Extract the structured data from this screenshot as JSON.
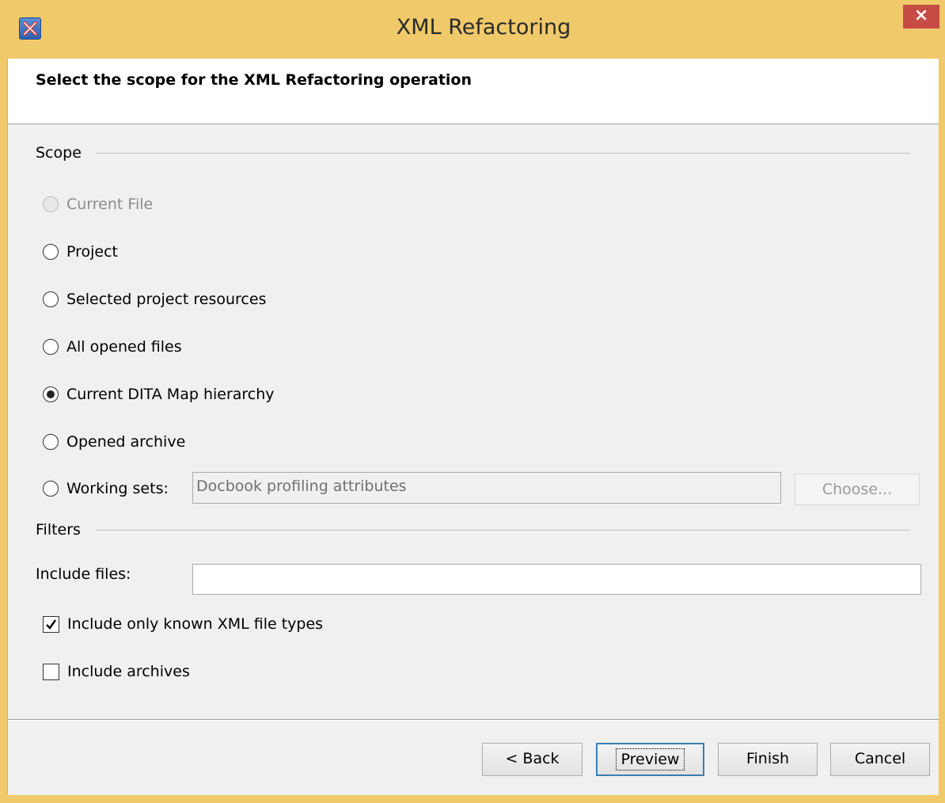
{
  "window": {
    "title": "XML Refactoring",
    "close_glyph": "×",
    "app_icon": "xml-refactoring-app-icon"
  },
  "header": {
    "title": "Select the scope for the XML Refactoring operation"
  },
  "scope": {
    "section_label": "Scope",
    "options": [
      {
        "label": "Current File",
        "checked": false,
        "disabled": true
      },
      {
        "label": "Project",
        "checked": false,
        "disabled": false
      },
      {
        "label": "Selected project resources",
        "checked": false,
        "disabled": false
      },
      {
        "label": "All opened files",
        "checked": false,
        "disabled": false
      },
      {
        "label": "Current DITA Map hierarchy",
        "checked": true,
        "disabled": false
      },
      {
        "label": "Opened archive",
        "checked": false,
        "disabled": false
      },
      {
        "label": "Working sets:",
        "checked": false,
        "disabled": false
      }
    ],
    "working_sets_value": "Docbook profiling attributes",
    "choose_button": "Choose..."
  },
  "filters": {
    "section_label": "Filters",
    "include_files_label": "Include files:",
    "include_files_value": "",
    "known_xml_label": "Include only known XML file types",
    "known_xml_checked": true,
    "archives_label": "Include archives",
    "archives_checked": false
  },
  "footer": {
    "back": "< Back",
    "preview": "Preview",
    "finish": "Finish",
    "cancel": "Cancel"
  },
  "colors": {
    "titlebar": "#f0c96a",
    "close_button": "#c74b45",
    "dialog_background": "#f0f0f0",
    "header_background": "#ffffff"
  }
}
